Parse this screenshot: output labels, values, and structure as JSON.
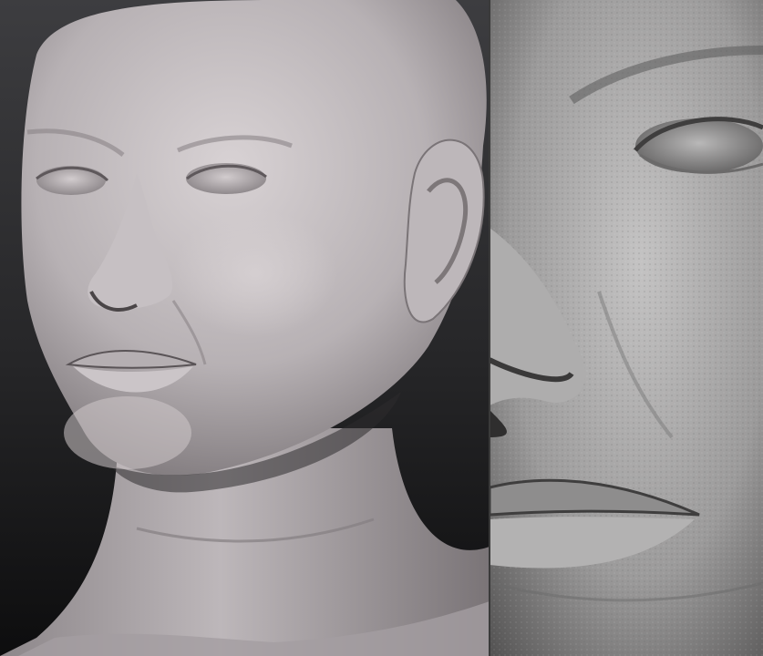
{
  "image": {
    "subject": "",
    "panels": [
      {
        "id": "left",
        "view": ""
      },
      {
        "id": "right",
        "view": ""
      }
    ]
  },
  "colors": {
    "background_top": "#3b3b3d",
    "background_bottom": "#0f0f10",
    "clay_light": "#cfc9cb",
    "clay_mid": "#a9a3a6",
    "clay_dark": "#6f6a6d",
    "shadow": "#2e2b2d",
    "detail_clay_light": "#bdbcbc",
    "detail_clay_dark": "#4f4f4f"
  }
}
